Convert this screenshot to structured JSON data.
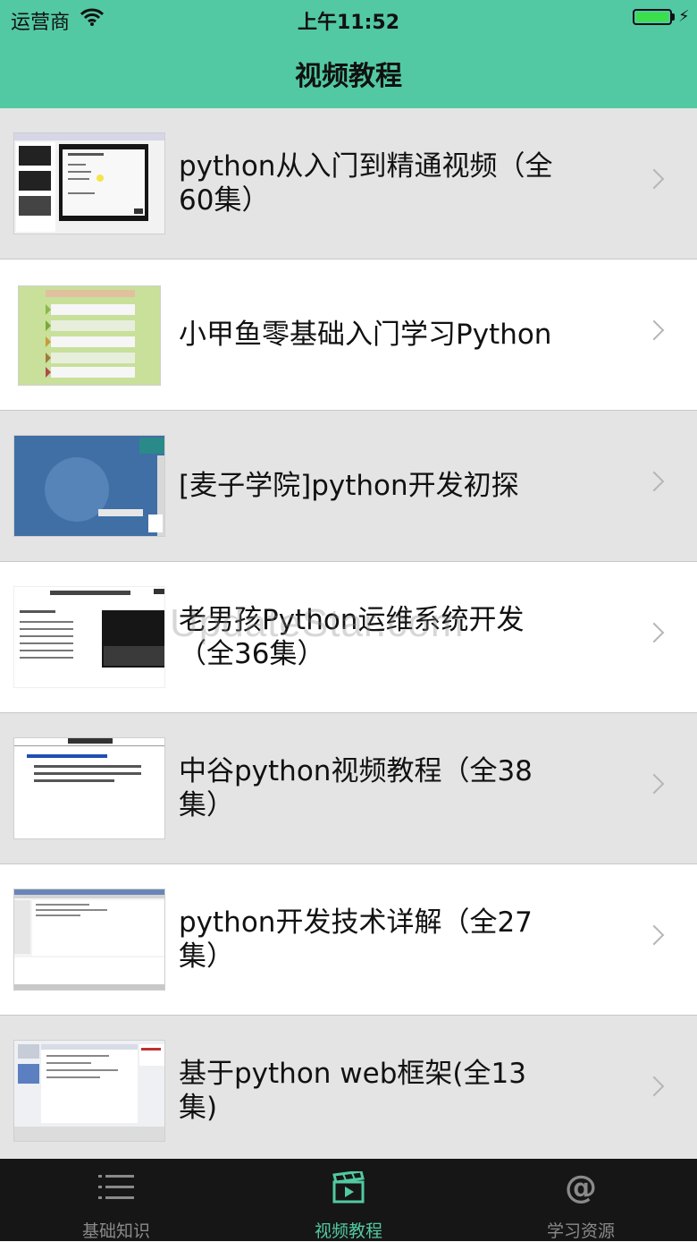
{
  "status_bar": {
    "carrier": "运营商",
    "time": "上午11:52"
  },
  "nav": {
    "title": "视频教程"
  },
  "list": {
    "items": [
      {
        "title": "python从入门到精通视频（全60集）"
      },
      {
        "title": "小甲鱼零基础入门学习Python"
      },
      {
        "title": "[麦子学院]python开发初探"
      },
      {
        "title": "老男孩Python运维系统开发（全36集）"
      },
      {
        "title": "中谷python视频教程（全38集）"
      },
      {
        "title": "python开发技术详解（全27集）"
      },
      {
        "title": "基于python web框架(全13集)"
      }
    ]
  },
  "tabbar": {
    "tabs": [
      {
        "label": "基础知识",
        "icon": "list-icon",
        "active": false
      },
      {
        "label": "视频教程",
        "icon": "clapperboard-icon",
        "active": true
      },
      {
        "label": "学习资源",
        "icon": "at-icon",
        "active": false
      }
    ]
  },
  "watermark": "UpdateStar.com",
  "colors": {
    "accent": "#52c9a2",
    "tabbar": "#161616",
    "row_alt": "#e4e4e4"
  }
}
